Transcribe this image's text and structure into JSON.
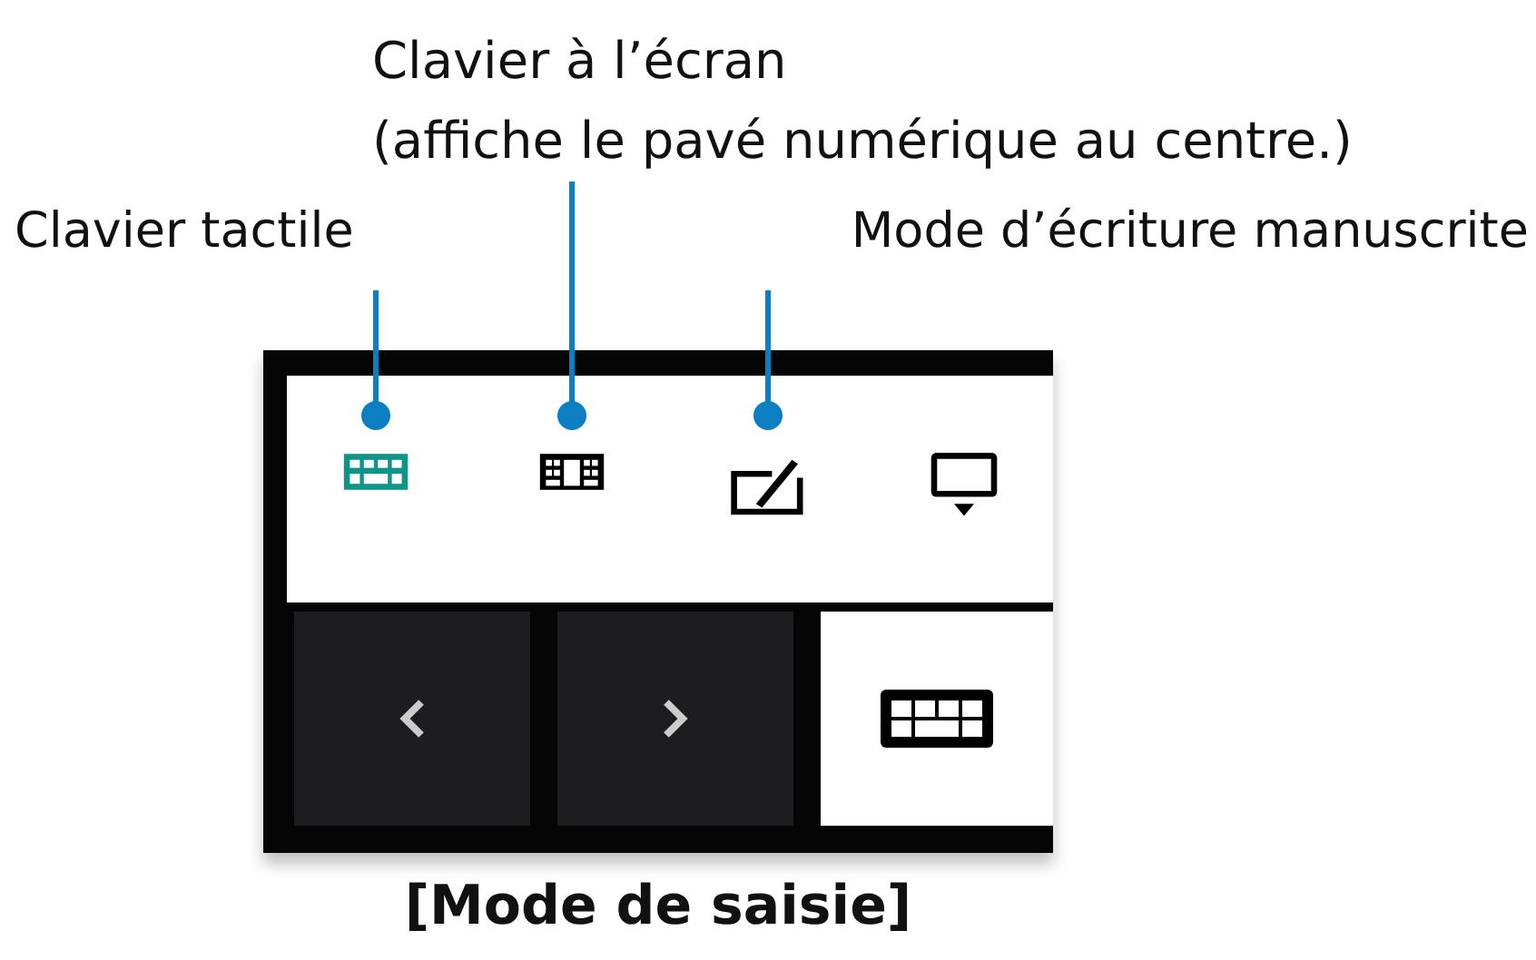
{
  "modes": [
    {
      "kind": "touch-keyboard",
      "selected": true,
      "callout": [
        "Clavier tactile"
      ]
    },
    {
      "kind": "split-keyboard",
      "selected": false,
      "callout": [
        "Clavier à l’écran",
        "(affiche le pavé numérique au centre.)"
      ]
    },
    {
      "kind": "handwriting",
      "selected": false,
      "callout": [
        "Mode d’écriture manuscrite"
      ]
    },
    {
      "kind": "dock",
      "selected": false
    }
  ],
  "bottom_buttons": [
    {
      "kind": "prev",
      "selected": false
    },
    {
      "kind": "next",
      "selected": false
    },
    {
      "kind": "keyboard",
      "selected": true
    }
  ],
  "caption": "[Mode de saisie]"
}
